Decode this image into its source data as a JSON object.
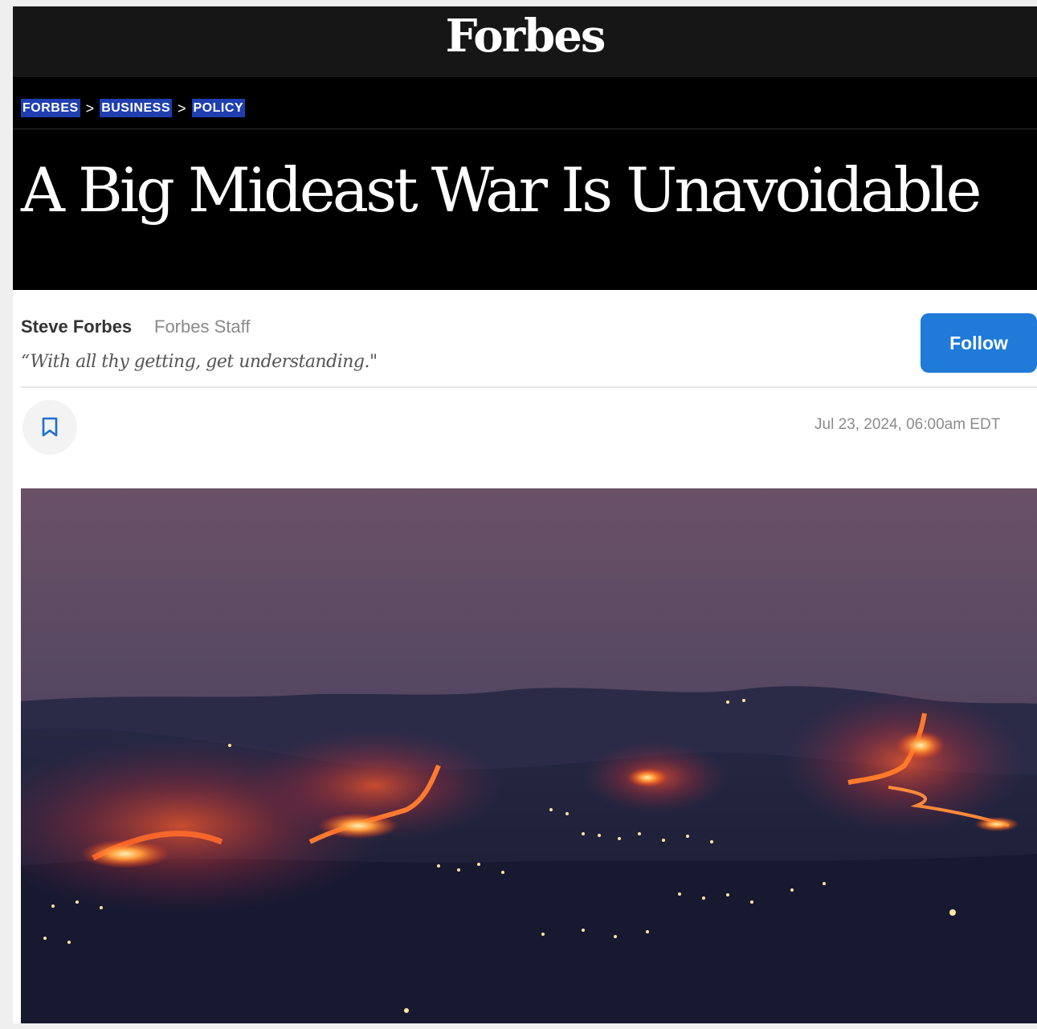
{
  "site": {
    "logo": "Forbes"
  },
  "breadcrumb": [
    {
      "label": "FORBES"
    },
    {
      "label": "BUSINESS"
    },
    {
      "label": "POLICY"
    }
  ],
  "breadcrumb_separator": ">",
  "article": {
    "headline": "A Big Mideast War Is Unavoidable",
    "author": "Steve Forbes",
    "author_role": "Forbes Staff",
    "tagline": "“With all thy getting, get understanding.\"",
    "follow_label": "Follow",
    "timestamp": "Jul 23, 2024, 06:00am EDT"
  },
  "icons": {
    "save": "bookmark-icon"
  },
  "colors": {
    "top_bar": "#161616",
    "hero": "#000000",
    "breadcrumb_highlight": "#1f3fb0",
    "follow_button": "#1f7ad8",
    "bookmark_icon": "#1f6fd0"
  }
}
